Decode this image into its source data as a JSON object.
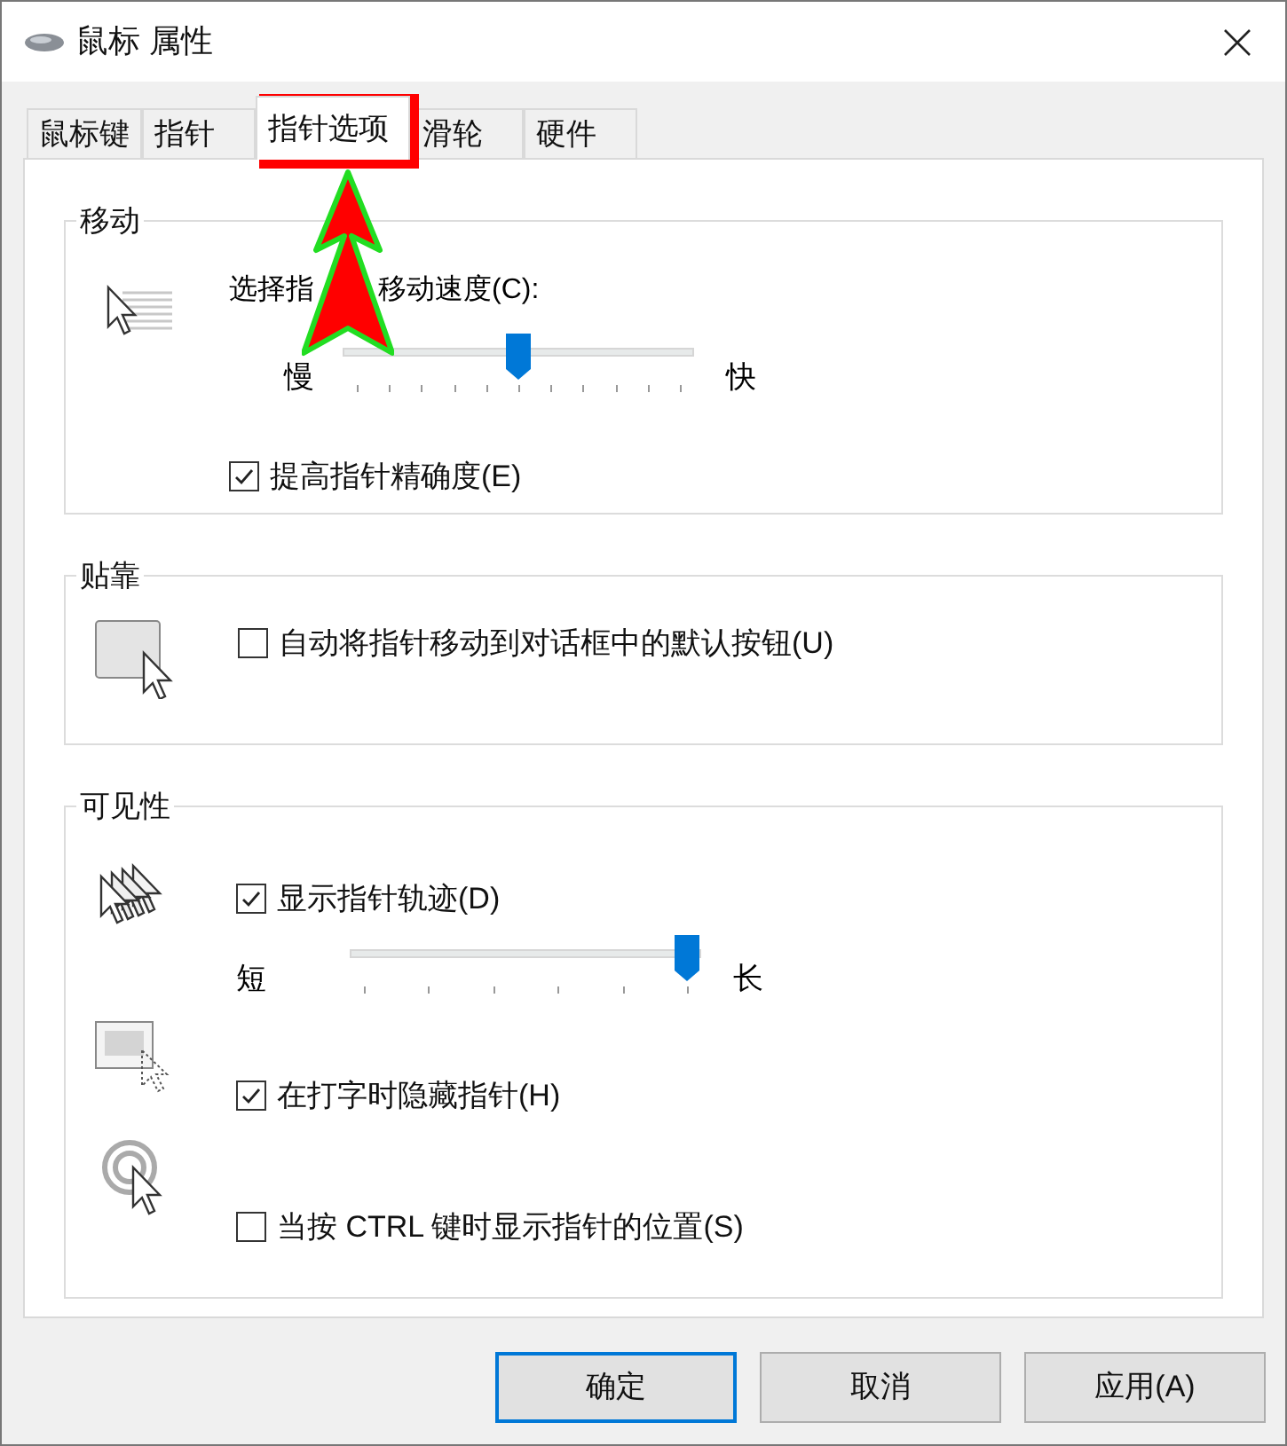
{
  "window": {
    "title": "鼠标 属性"
  },
  "tabs": [
    {
      "label": "鼠标键",
      "selected": false
    },
    {
      "label": "指针",
      "selected": false
    },
    {
      "label": "指针选项",
      "selected": true
    },
    {
      "label": "滑轮",
      "selected": false
    },
    {
      "label": "硬件",
      "selected": false
    }
  ],
  "motion": {
    "title": "移动",
    "speed_label_parts": [
      "选择指",
      "移动速度(C):"
    ],
    "slider": {
      "min_label": "慢",
      "max_label": "快",
      "level": 0.5
    },
    "precision": {
      "label": "提高指针精确度(E)",
      "checked": true
    }
  },
  "snap": {
    "title": "贴靠",
    "checkbox": {
      "label": "自动将指针移动到对话框中的默认按钮(U)",
      "checked": false
    }
  },
  "visibility": {
    "title": "可见性",
    "trails": {
      "label": "显示指针轨迹(D)",
      "checked": true
    },
    "trail_slider": {
      "min_label": "短",
      "max_label": "长",
      "level": 1
    },
    "hide": {
      "label": "在打字时隐藏指针(H)",
      "checked": true
    },
    "ctrl": {
      "label": "当按 CTRL 键时显示指针的位置(S)",
      "checked": false
    }
  },
  "buttons": [
    {
      "label": "确定",
      "default": true
    },
    {
      "label": "取消",
      "default": false
    },
    {
      "label": "应用(A)",
      "default": false
    }
  ]
}
